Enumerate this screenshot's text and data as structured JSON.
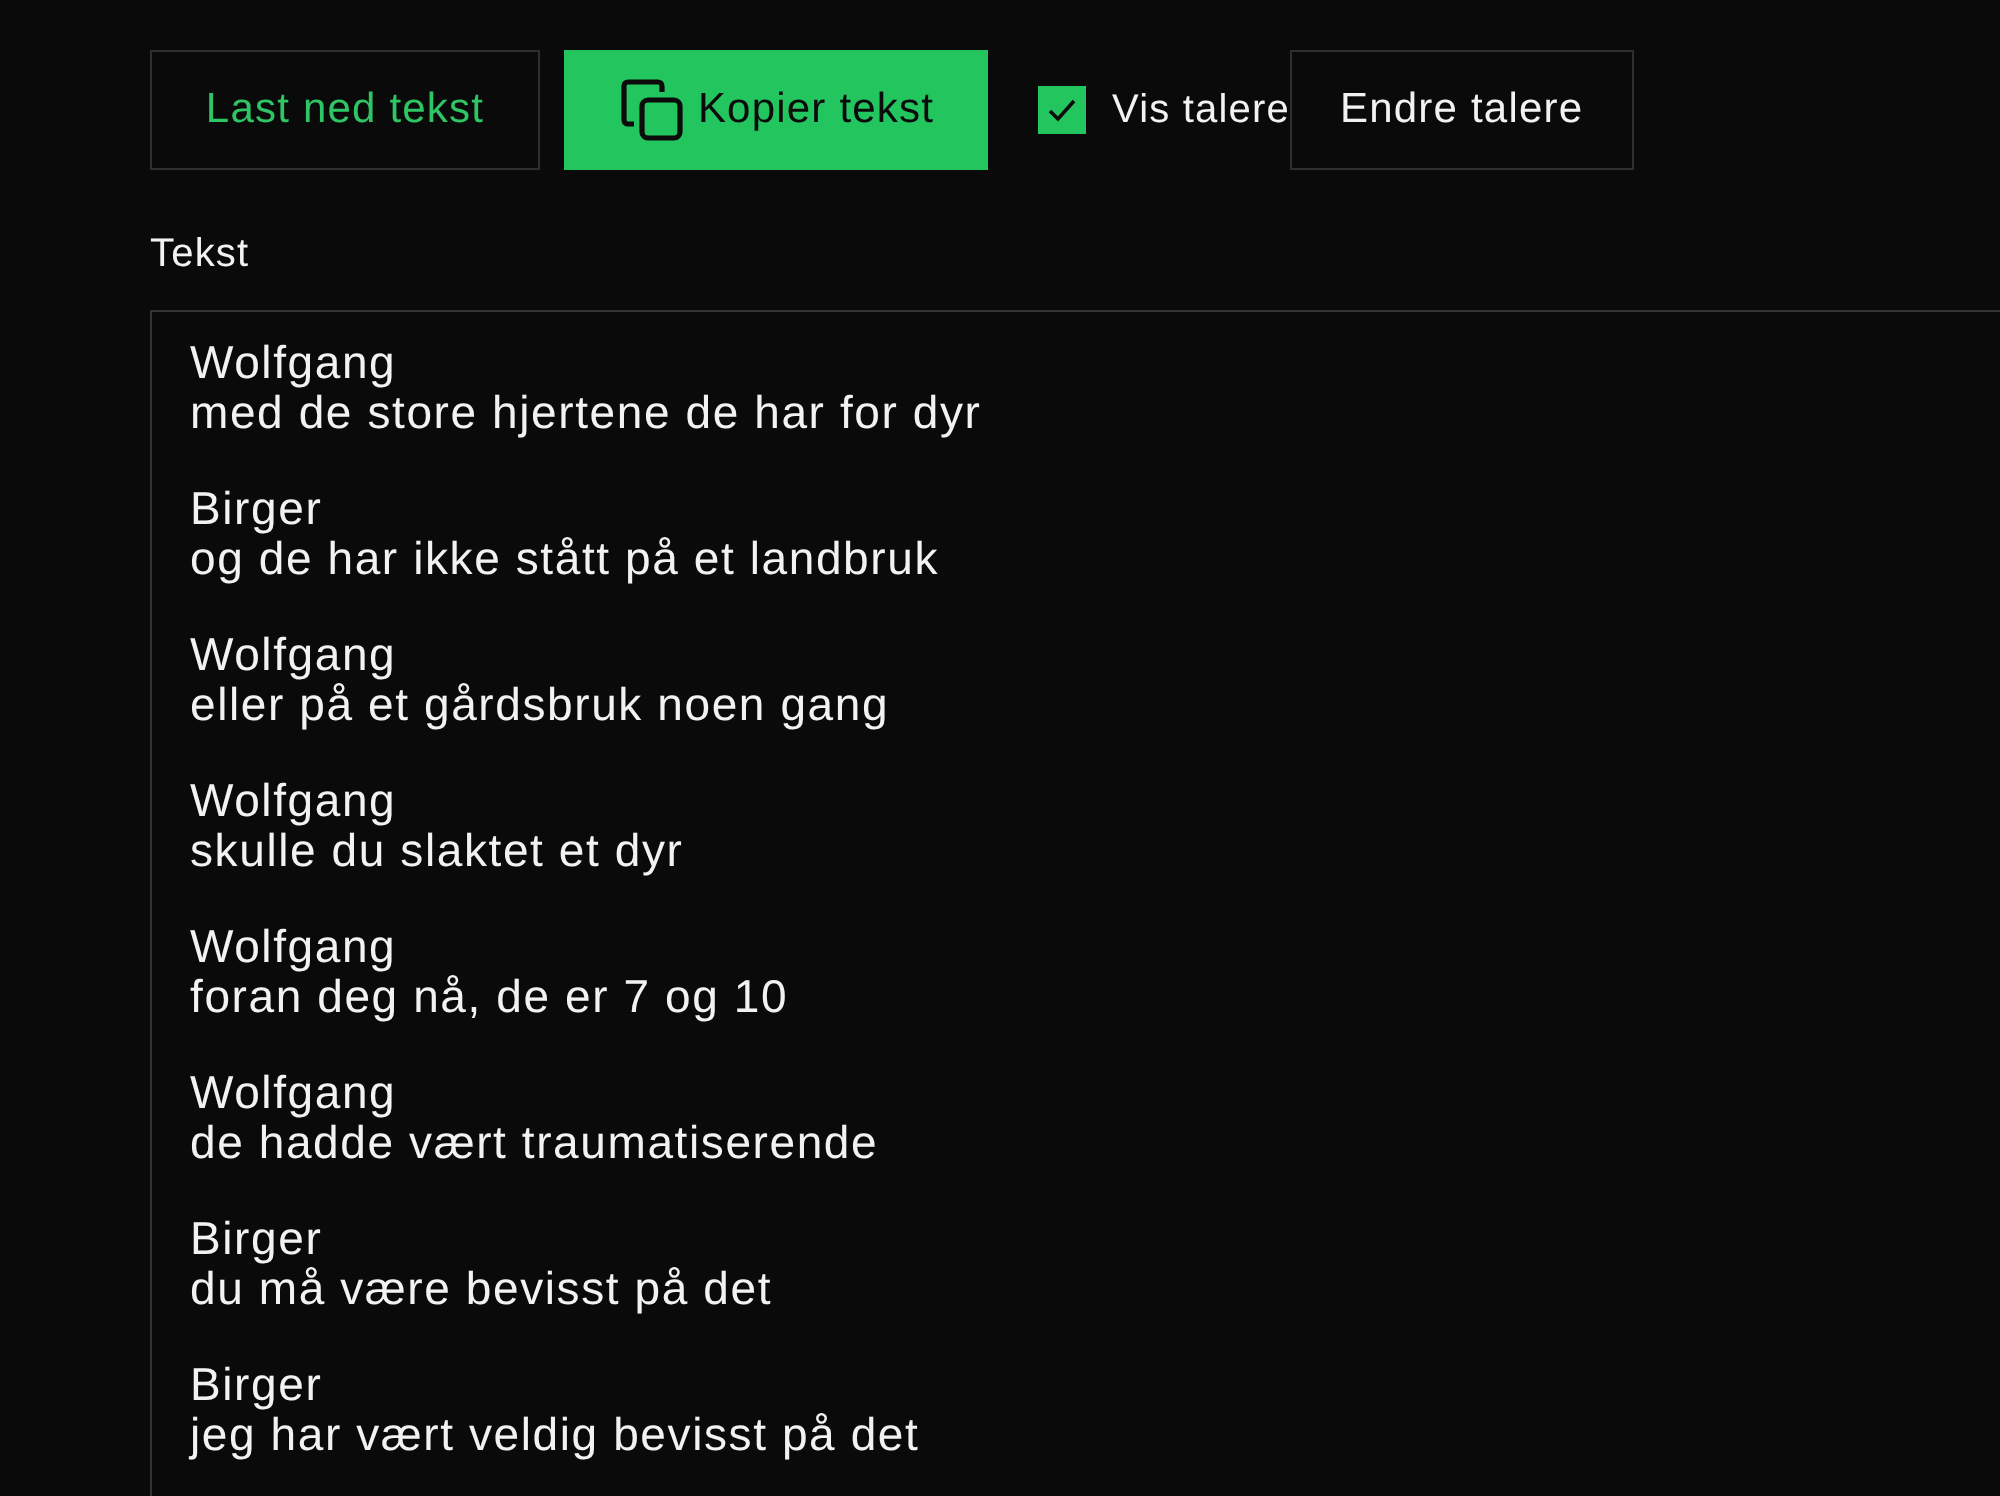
{
  "toolbar": {
    "download_button": "Last ned tekst",
    "copy_button": "Kopier tekst",
    "show_speakers": {
      "label": "Vis talere",
      "checked": true
    },
    "edit_speakers_button": "Endre talere"
  },
  "text_field": {
    "label": "Tekst",
    "entries": [
      {
        "speaker": "Wolfgang",
        "text": "med de store hjertene de har for dyr"
      },
      {
        "speaker": "Birger",
        "text": "og de har ikke stått på et landbruk"
      },
      {
        "speaker": "Wolfgang",
        "text": "eller på et gårdsbruk noen gang"
      },
      {
        "speaker": "Wolfgang",
        "text": "skulle du slaktet et dyr"
      },
      {
        "speaker": "Wolfgang",
        "text": "foran deg nå, de er 7 og 10"
      },
      {
        "speaker": "Wolfgang",
        "text": "de hadde vært traumatiserende"
      },
      {
        "speaker": "Birger",
        "text": "du må være bevisst på det"
      },
      {
        "speaker": "Birger",
        "text": "jeg har vært veldig bevisst på det"
      }
    ]
  }
}
